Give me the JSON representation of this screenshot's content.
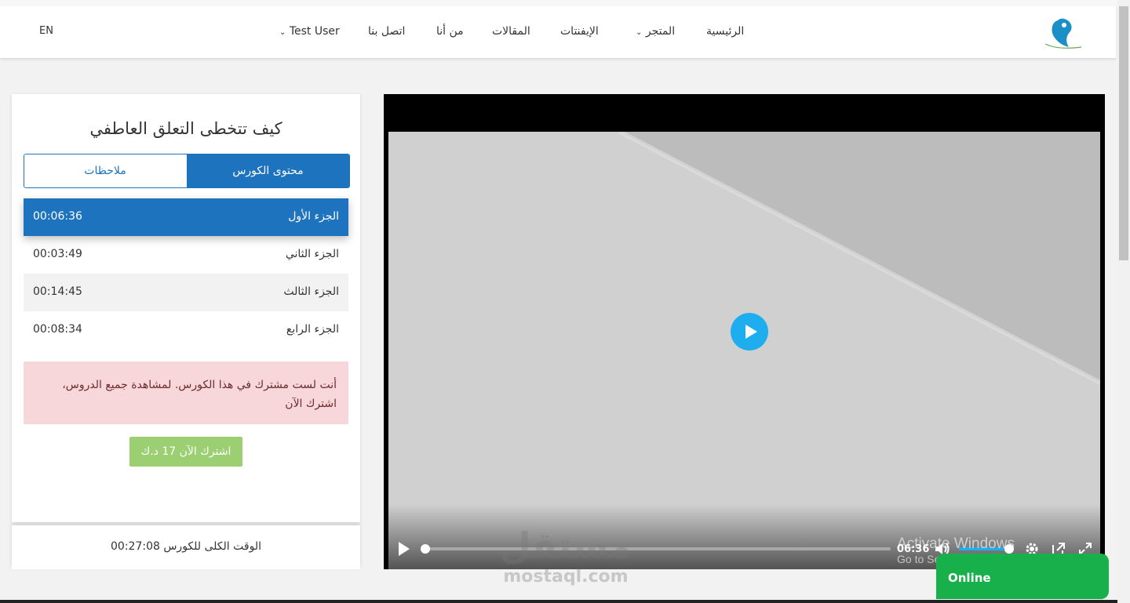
{
  "nav": {
    "lang": "EN",
    "items": {
      "home": "الرئيسية",
      "store": "المتجر",
      "infographics": "الإيفنتات",
      "articles": "المقالات",
      "about": "من أنا",
      "contact": "اتصل بنا",
      "user": "Test User"
    }
  },
  "course": {
    "title": "كيف تتخطى التعلق العاطفي",
    "tabs": {
      "content": "محتوى الكورس",
      "notes": "ملاحظات"
    },
    "parts": [
      {
        "name": "الجزء الأول",
        "time": "00:06:36"
      },
      {
        "name": "الجزء الثاني",
        "time": "00:03:49"
      },
      {
        "name": "الجزء الثالث",
        "time": "00:14:45"
      },
      {
        "name": "الجزء الرابع",
        "time": "00:08:34"
      }
    ],
    "alert": "أنت لست مشترك في هذا الكورس. لمشاهدة جميع الدروس، اشترك الآن",
    "subscribe": "اشترك الآن 17 د.ك",
    "total": "الوقت الكلى للكورس 00:27:08"
  },
  "player": {
    "time": "06:36",
    "progress": 0,
    "volume": 1
  },
  "watermark": {
    "arabic": "مستقل",
    "latin": "mostaql.com"
  },
  "windows": {
    "title": "Activate Windows",
    "subtitle": "Go to Settings to activate Windows."
  },
  "chat": {
    "label": "Online"
  },
  "colors": {
    "primary": "#1e73be",
    "subscribe": "#9bcf72",
    "play": "#1eaef0",
    "online": "#18b04a",
    "alert": "#f8d7da"
  },
  "icons": [
    "logo-icon",
    "chevron-down-icon",
    "play-icon",
    "volume-icon",
    "settings-icon",
    "popout-icon",
    "fullscreen-icon"
  ]
}
